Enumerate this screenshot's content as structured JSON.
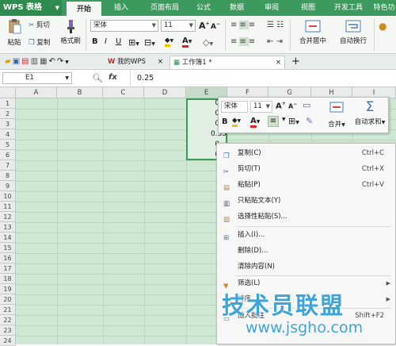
{
  "app": {
    "brand": "WPS 表格"
  },
  "tabs": [
    "开始",
    "插入",
    "页面布局",
    "公式",
    "数据",
    "审阅",
    "视图",
    "开发工具",
    "特色功"
  ],
  "active_tab": "开始",
  "ribbon": {
    "paste": "粘贴",
    "cut": "剪切",
    "copy": "复制",
    "format_painter": "格式刷",
    "font_name": "宋体",
    "font_size": "11",
    "bold": "B",
    "italic": "I",
    "underline": "U",
    "grow_font": "A",
    "shrink_font": "A",
    "merge_center": "合并居中",
    "wrap": "自动换行",
    "font_color_letter": "A"
  },
  "doc_tabs": [
    {
      "label": "我的WPS"
    },
    {
      "label": "工作簿1 *"
    }
  ],
  "formula_bar": {
    "name_box": "E1",
    "fx": "fx",
    "value": "0.25"
  },
  "columns": [
    "A",
    "B",
    "C",
    "D",
    "E",
    "F",
    "G",
    "H",
    "I"
  ],
  "rows": [
    "1",
    "2",
    "3",
    "4",
    "5",
    "6",
    "7",
    "8",
    "9",
    "10",
    "11",
    "12",
    "13",
    "14",
    "15",
    "16",
    "17",
    "18",
    "19",
    "20",
    "21",
    "22",
    "23",
    "24"
  ],
  "cells_e": [
    "0.",
    "0.",
    "0.",
    "0.35",
    "0.",
    "0."
  ],
  "mini_toolbar": {
    "font": "宋体",
    "size": "11",
    "grow": "A",
    "shrink": "A",
    "bold": "B",
    "font_color": "A",
    "merge": "合并",
    "autosum": "自动求和"
  },
  "context_menu": [
    {
      "label": "复制(C)",
      "shortcut": "Ctrl+C",
      "icon": "copy-icon"
    },
    {
      "label": "剪切(T)",
      "shortcut": "Ctrl+X",
      "icon": "scissors-icon"
    },
    {
      "label": "粘贴(P)",
      "shortcut": "Ctrl+V",
      "icon": "paste-icon"
    },
    {
      "label": "只粘贴文本(Y)",
      "shortcut": "",
      "icon": "paste-text-icon"
    },
    {
      "label": "选择性粘贴(S)...",
      "shortcut": "",
      "icon": "paste-special-icon"
    },
    {
      "label": "插入(I)...",
      "shortcut": "",
      "icon": "insert-icon"
    },
    {
      "label": "删除(D)...",
      "shortcut": "",
      "icon": ""
    },
    {
      "label": "清除内容(N)",
      "shortcut": "",
      "icon": ""
    },
    {
      "label": "筛选(L)",
      "shortcut": "",
      "icon": "filter-icon"
    },
    {
      "label": "排序",
      "shortcut": "",
      "icon": "sort-icon"
    },
    {
      "label": "插入批注",
      "shortcut": "Shift+F2",
      "icon": "comment-icon"
    }
  ],
  "watermark": {
    "line1": "技术员联盟",
    "line2": "www.jsgho.com"
  }
}
